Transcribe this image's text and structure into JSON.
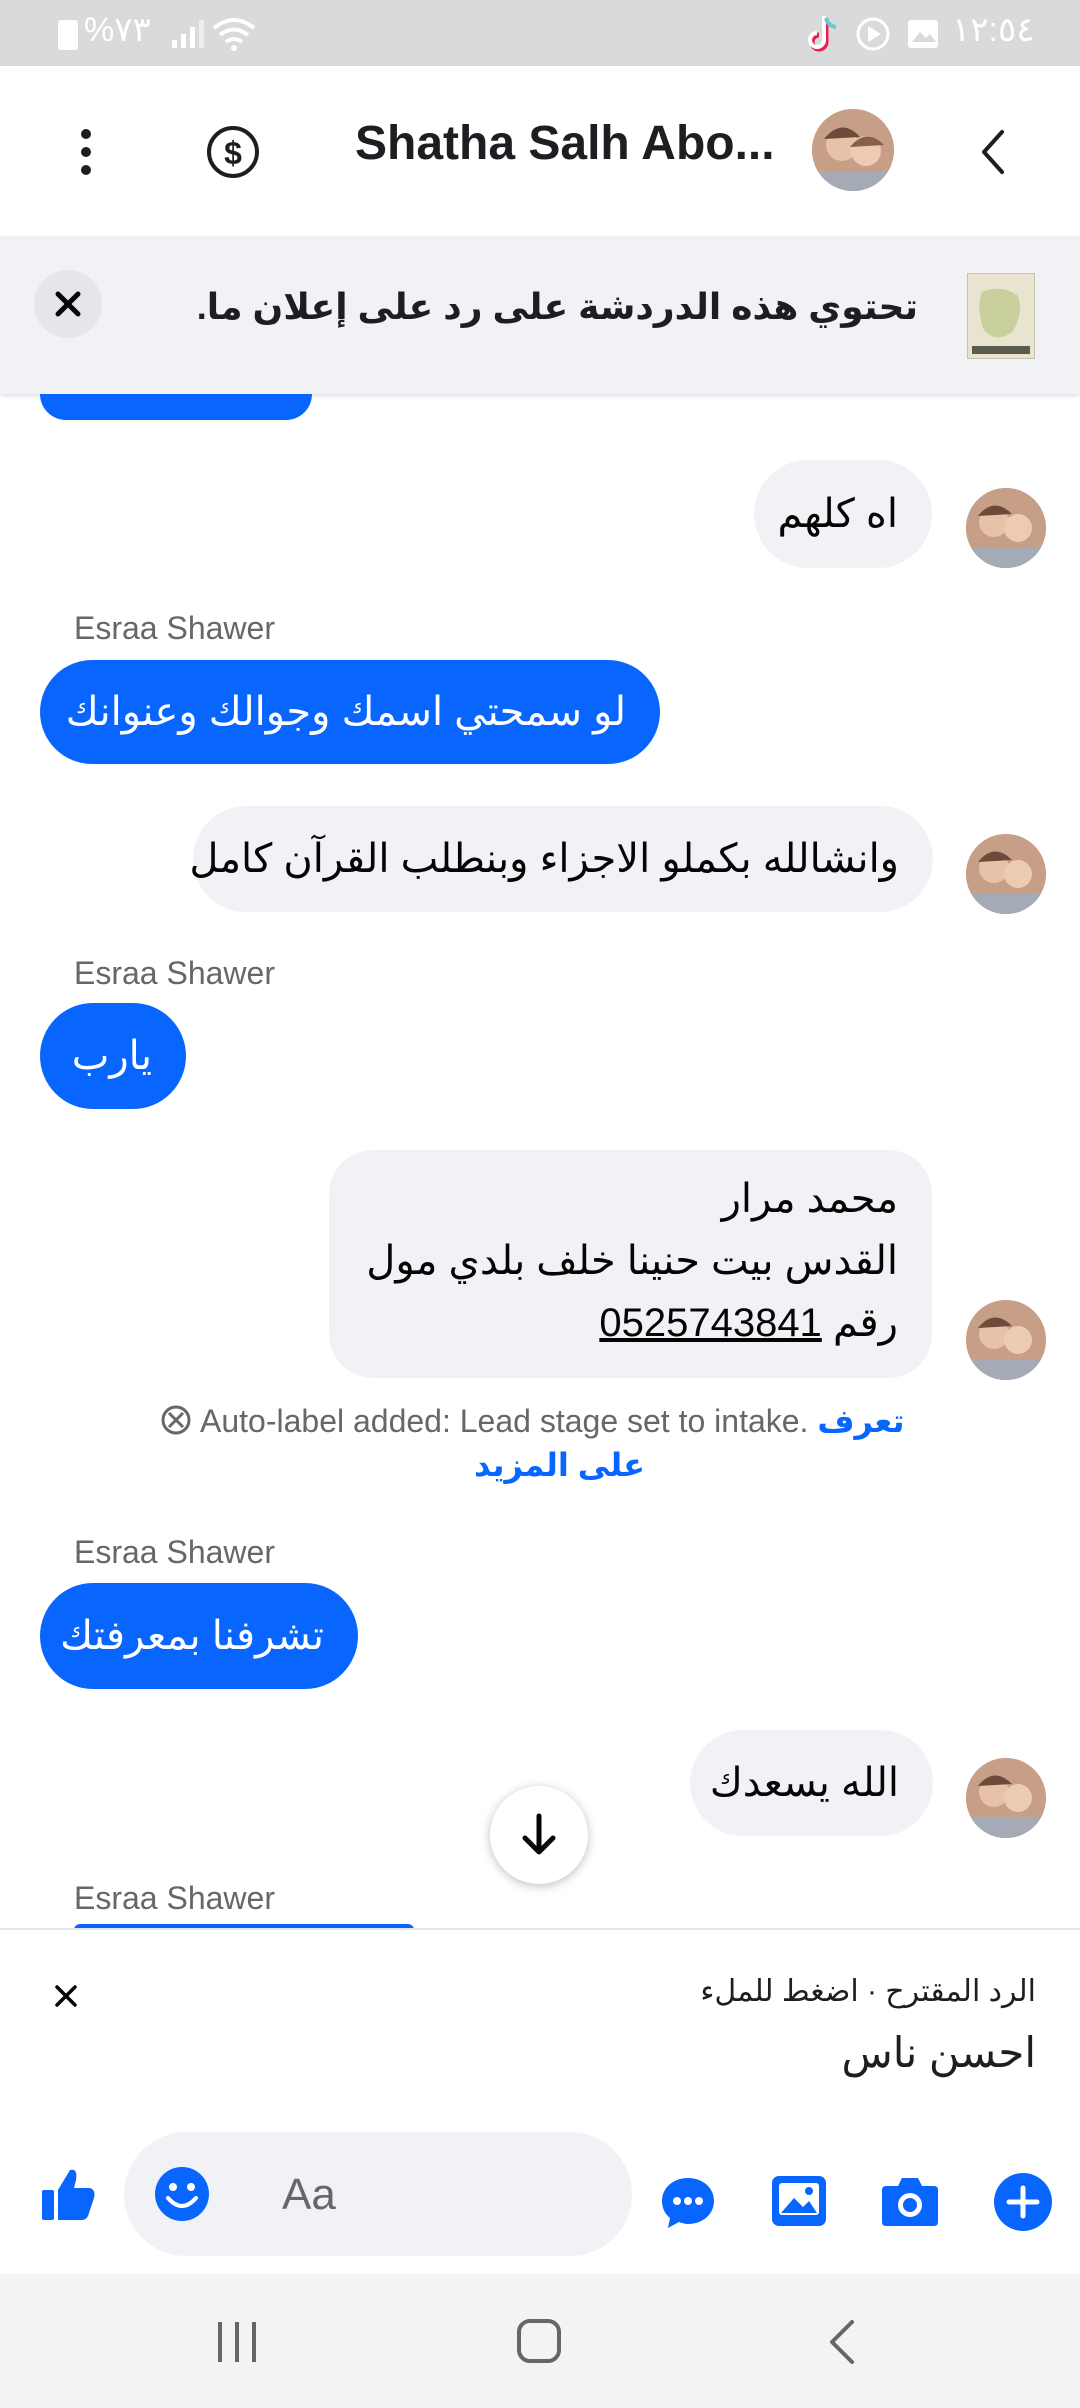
{
  "status_bar": {
    "time": "١٢:٥٤",
    "battery": "%٧٣"
  },
  "header": {
    "title": "Shatha Salh Abo..."
  },
  "ad_banner": {
    "text": "تحتوي هذه الدردشة على رد على إعلان ما."
  },
  "messages": [
    {
      "side": "in",
      "text": "اه كلهم"
    },
    {
      "side": "out",
      "sender": "Esraa Shawer",
      "text": "لو سمحتي اسمك وجوالك وعنوانك"
    },
    {
      "side": "in",
      "text": "وانشالله بكملو الاجزاء وبنطلب القرآن كامل"
    },
    {
      "side": "out",
      "sender": "Esraa Shawer",
      "text": "يارب"
    },
    {
      "side": "in",
      "lines": [
        "محمد مرار",
        "القدس بيت حنينا خلف بلدي مول",
        "رقم",
        "0525743841"
      ]
    },
    {
      "side": "out",
      "sender": "Esraa Shawer",
      "text": "تشرفنا بمعرفتك"
    },
    {
      "side": "in",
      "text": "الله يسعدك"
    },
    {
      "side": "out",
      "sender": "Esraa Shawer",
      "text": ""
    }
  ],
  "system_notice": {
    "text": "Auto-label added: Lead stage set to intake.",
    "link_part1": "تعرف",
    "link_part2": "على المزيد"
  },
  "suggested_reply": {
    "label": "الرد المقترح · اضغط للملء",
    "text": "احسن ناس"
  },
  "composer": {
    "placeholder": "Aa"
  },
  "colors": {
    "accent": "#0866ff",
    "incoming_bubble": "#f0f2f5"
  }
}
